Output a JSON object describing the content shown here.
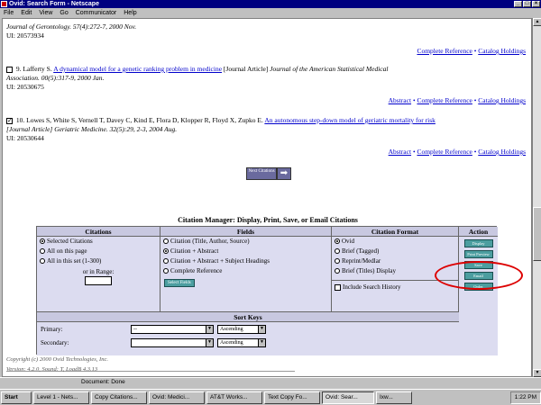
{
  "window": {
    "title": "Ovid: Search Form - Netscape"
  },
  "menu": [
    "File",
    "Edit",
    "View",
    "Go",
    "Communicator",
    "Help"
  ],
  "records": {
    "r0": {
      "line1": "Journal of Gerontology. 57(4):272-7, 2000 Nov.",
      "line2": "UI: 20573934"
    },
    "r0_links": {
      "complete": "Complete Reference",
      "catalog": "Catalog Holdings"
    },
    "r9": {
      "num": "9.",
      "authors": "Lafferty S.",
      "title": "A dynamical model for a genetic ranking problem in medicine",
      "type": "[Journal Article]",
      "journal": "Journal of the American Statistical Medical",
      "line2": "Association. 00(5):317-9, 2000 Jan.",
      "ui": "UI: 20530675"
    },
    "r9_links": {
      "abstract": "Abstract",
      "complete": "Complete Reference",
      "catalog": "Catalog Holdings"
    },
    "r10": {
      "num": "10.",
      "authors": "Lowes S, White S, Vernell T, Davey C, Kind E, Flora D, Klopper R, Floyd X, Zupko E.",
      "title": "An autonomous step-down model of geriatric mortality for risk",
      "line2": "[Journal Article] Geriatric Medicine. 32(5):29, 2-3, 2004 Aug.",
      "ui": "UI: 20530644"
    },
    "r10_links": {
      "abstract": "Abstract",
      "complete": "Complete Reference",
      "catalog": "Catalog Holdings"
    }
  },
  "nav": {
    "next_label": "Next Citations"
  },
  "citation_manager": {
    "title": "Citation Manager: Display, Print, Save, or Email Citations",
    "citations": {
      "header": "Citations",
      "options": [
        "Selected Citations",
        "All on this page",
        "All in this set (1-300)"
      ],
      "range_label": "or in Range:"
    },
    "fields": {
      "header": "Fields",
      "options": [
        "Citation (Title, Author, Source)",
        "Citation + Abstract",
        "Citation + Abstract + Subject Headings",
        "Complete Reference"
      ],
      "select_button": "Select Fields"
    },
    "format": {
      "header": "Citation Format",
      "options": [
        "Ovid",
        "Brief (Tagged)",
        "Reprint/Medlar",
        "Brief (Titles) Display"
      ],
      "history_label": "Include Search History"
    },
    "action": {
      "header": "Action",
      "buttons": [
        "Display",
        "Print Preview",
        "Save",
        "Email",
        "Order"
      ]
    },
    "sort": {
      "header": "Sort Keys",
      "primary_label": "Primary:",
      "secondary_label": "Secondary:",
      "primary_value": "--",
      "secondary_value": "",
      "primary_order": "Ascending",
      "secondary_order": "Ascending"
    }
  },
  "footer": {
    "copyright": "Copyright (c) 2000 Ovid Technologies, Inc.",
    "version": "Version: 4.2.0, Sound: T, LoadB 4.3.13"
  },
  "status": {
    "text": "Document: Done"
  },
  "taskbar": {
    "start": "Start",
    "items": [
      "Level 1 - Nets...",
      "Copy Citations...",
      "Ovid: Medici...",
      "AT&T Works...",
      "Text Copy Fo...",
      "Ovid: Sear...",
      "Ixw..."
    ],
    "clock": "1:22 PM"
  }
}
